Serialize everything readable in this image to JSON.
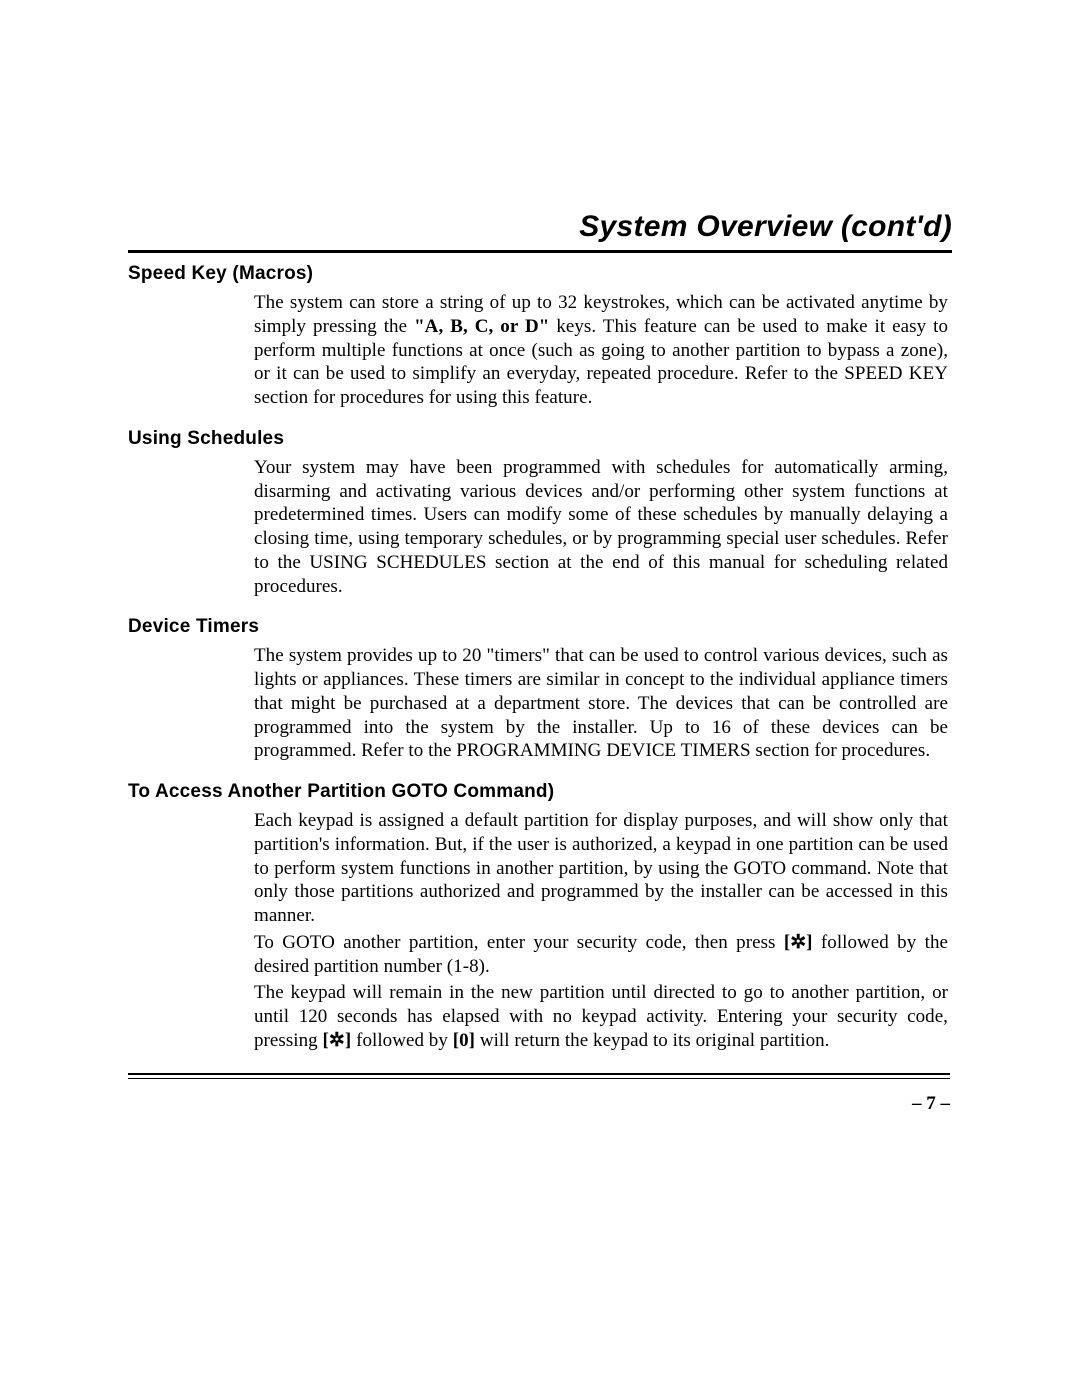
{
  "page": {
    "title": "System Overview (cont'd)",
    "page_number": "– 7 –"
  },
  "sections": {
    "speed_key": {
      "heading": "Speed Key (Macros)",
      "p1": {
        "t1": "The system can store a string of up to 32 keystrokes, which can be activated anytime by simply pressing the ",
        "b1": "\"A, B, C, or D\"",
        "t2": " keys. This feature can be used to make it easy to perform multiple functions at once (such as going to another partition to bypass a zone), or it can be used to simplify an everyday, repeated procedure. Refer to the SPEED KEY section for procedures for using this feature."
      }
    },
    "using_schedules": {
      "heading": "Using Schedules",
      "p1": "Your system may have been programmed with schedules for automatically arming, disarming and activating various devices and/or performing other system functions at predetermined times. Users can modify some of these schedules by manually delaying a closing time, using temporary schedules, or by programming special user schedules. Refer to the USING SCHEDULES section at the end of this manual for scheduling related procedures."
    },
    "device_timers": {
      "heading": "Device Timers",
      "p1": "The system provides up to 20 \"timers\" that can be used to control various devices, such as lights or appliances. These timers are similar in concept to the individual appliance timers that might be purchased at a department store. The devices that can be controlled are programmed into the system by the installer. Up to 16 of these devices can be programmed. Refer to the PROGRAMMING DEVICE TIMERS section for procedures."
    },
    "goto": {
      "heading": "To Access Another Partition GOTO Command)",
      "p1": "Each keypad is assigned a default partition for display purposes, and will show only that partition's information. But, if the user is authorized, a keypad in one partition can be used to perform system functions in another partition, by using the GOTO command. Note that only those partitions authorized and programmed by the installer can be accessed in this manner.",
      "p2": {
        "t1": "To GOTO another partition, enter your security code, then press ",
        "b1": "[✲]",
        "t2": " followed by the desired partition number (1-8)."
      },
      "p3": {
        "t1": "The keypad will remain in the new partition until directed to go to another partition, or until 120 seconds has elapsed with no keypad activity. Entering your security code, pressing ",
        "b1": "[✲]",
        "t2": " followed by ",
        "b2": "[0]",
        "t3": " will return the keypad to its original partition."
      }
    }
  }
}
